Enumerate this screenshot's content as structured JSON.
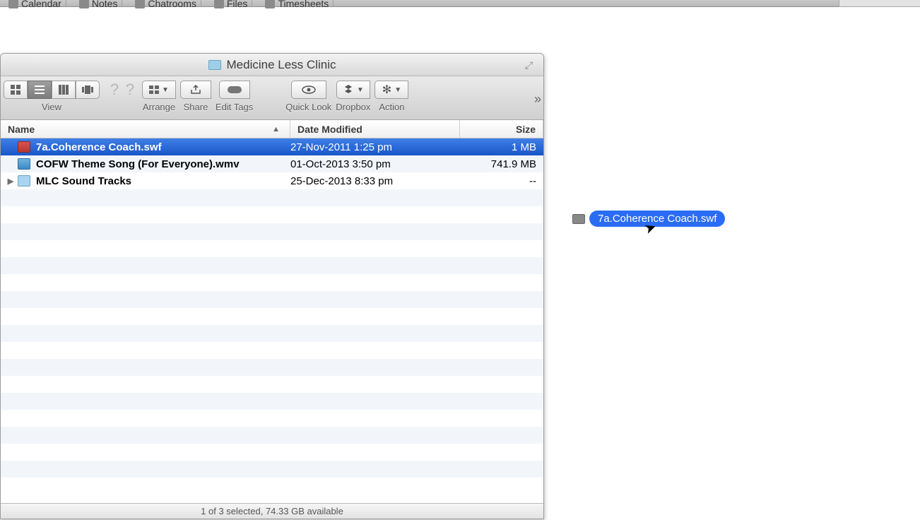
{
  "menubar": {
    "items": [
      "Calendar",
      "Notes",
      "Chatrooms",
      "Files",
      "Timesheets"
    ]
  },
  "window": {
    "title": "Medicine Less Clinic",
    "toolbar": {
      "view_label": "View",
      "arrange_label": "Arrange",
      "share_label": "Share",
      "edit_tags_label": "Edit Tags",
      "quick_look_label": "Quick Look",
      "dropbox_label": "Dropbox",
      "action_label": "Action"
    },
    "columns": {
      "name": "Name",
      "date": "Date Modified",
      "size": "Size"
    },
    "rows": [
      {
        "name": "7a.Coherence Coach.swf",
        "date": "27-Nov-2011 1:25 pm",
        "size": "1 MB",
        "type": "swf",
        "selected": true,
        "expandable": false
      },
      {
        "name": "COFW Theme Song (For Everyone).wmv",
        "date": "01-Oct-2013 3:50 pm",
        "size": "741.9 MB",
        "type": "wmv",
        "selected": false,
        "expandable": false
      },
      {
        "name": "MLC Sound Tracks",
        "date": "25-Dec-2013 8:33 pm",
        "size": "--",
        "type": "folder",
        "selected": false,
        "expandable": true
      }
    ],
    "status": "1 of 3 selected, 74.33 GB available"
  },
  "drag_ghost": {
    "label": "7a.Coherence Coach.swf"
  }
}
